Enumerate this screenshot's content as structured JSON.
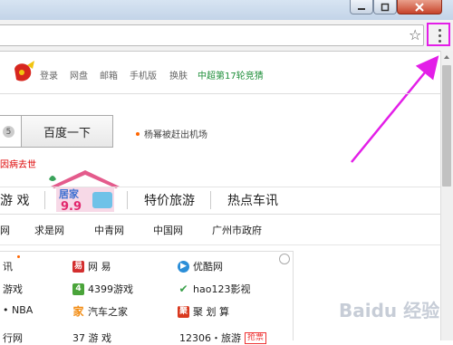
{
  "browser": {
    "star_icon": "star-icon",
    "menu_icon": "vertical-dots-icon"
  },
  "top_links": [
    "登录",
    "网盘",
    "邮箱",
    "手机版",
    "换肤",
    "中超第17轮竞猜"
  ],
  "search": {
    "count": "5",
    "button_label": "百度一下"
  },
  "news": {
    "hot": "杨幂被赶出机场",
    "red": "因病去世"
  },
  "categories": [
    "游 戏",
    "特价旅游",
    "热点车讯"
  ],
  "promo": {
    "line1": "居家",
    "line2": "9.9"
  },
  "sites": [
    "网",
    "求是网",
    "中青网",
    "中国网",
    "广州市政府"
  ],
  "links": {
    "r1": [
      "讯",
      "网   易",
      "优酷网"
    ],
    "r2": [
      "游戏",
      "4399游戏",
      "hao123影视"
    ],
    "r3": [
      "• NBA",
      "汽车之家",
      "聚 划 算"
    ],
    "r4": [
      "行网",
      "37 游 戏",
      "12306・旅游",
      "抢票"
    ]
  },
  "watermark": "Baidu 经验",
  "colors": {
    "accent": "#e31ee8",
    "link_green": "#1f8f3a",
    "news_red": "#dd0000"
  }
}
